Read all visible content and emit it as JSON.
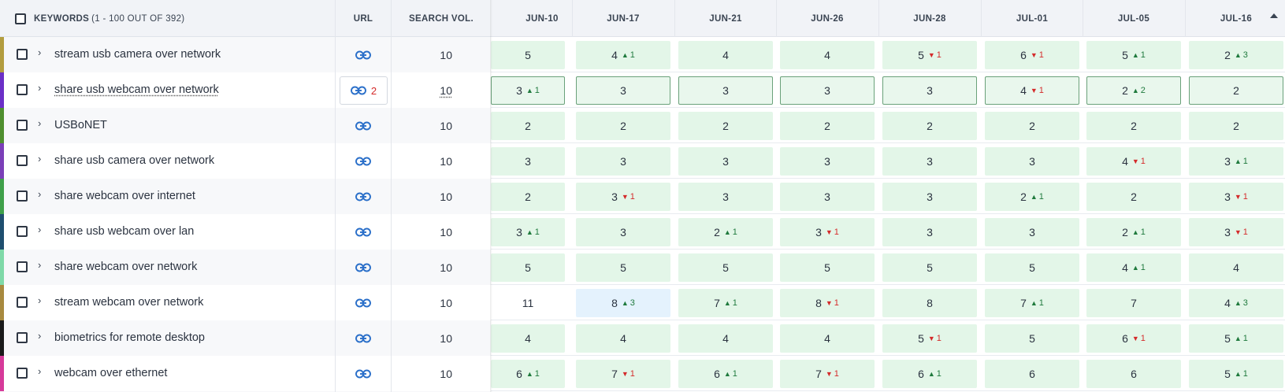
{
  "header": {
    "keywords_label": "KEYWORDS",
    "keywords_count": "(1 - 100 OUT OF 392)",
    "url_label": "URL",
    "volume_label": "SEARCH VOL.",
    "dates": [
      "JUN-10",
      "JUN-17",
      "JUN-21",
      "JUN-26",
      "JUN-28",
      "JUL-01",
      "JUL-05",
      "JUL-16"
    ]
  },
  "colors": {
    "positive_change": "#1f7a3d",
    "negative_change": "#d42b2b",
    "cell_green": "#e3f6e8",
    "cell_blue": "#e4f2fd"
  },
  "rows": [
    {
      "keyword": "stream usb camera over network",
      "stripe": "#b39d3f",
      "volume": "10",
      "cells": [
        {
          "v": "5",
          "c": "",
          "d": "",
          "bg": "green"
        },
        {
          "v": "4",
          "c": "1",
          "d": "up",
          "bg": "green"
        },
        {
          "v": "4",
          "c": "",
          "d": "",
          "bg": "green"
        },
        {
          "v": "4",
          "c": "",
          "d": "",
          "bg": "green"
        },
        {
          "v": "5",
          "c": "1",
          "d": "down",
          "bg": "green"
        },
        {
          "v": "6",
          "c": "1",
          "d": "down",
          "bg": "green"
        },
        {
          "v": "5",
          "c": "1",
          "d": "up",
          "bg": "green"
        },
        {
          "v": "2",
          "c": "3",
          "d": "up",
          "bg": "green"
        }
      ]
    },
    {
      "keyword": "share usb webcam over network",
      "stripe": "#6b2fc7",
      "volume": "10",
      "url_count": "2",
      "selected": true,
      "cells": [
        {
          "v": "3",
          "c": "1",
          "d": "up",
          "bg": "green"
        },
        {
          "v": "3",
          "c": "",
          "d": "",
          "bg": "green"
        },
        {
          "v": "3",
          "c": "",
          "d": "",
          "bg": "green"
        },
        {
          "v": "3",
          "c": "",
          "d": "",
          "bg": "green"
        },
        {
          "v": "3",
          "c": "",
          "d": "",
          "bg": "green"
        },
        {
          "v": "4",
          "c": "1",
          "d": "down",
          "bg": "green"
        },
        {
          "v": "2",
          "c": "2",
          "d": "up",
          "bg": "green"
        },
        {
          "v": "2",
          "c": "",
          "d": "",
          "bg": "green"
        }
      ]
    },
    {
      "keyword": "USBoNET",
      "stripe": "#4f8f2f",
      "volume": "10",
      "cells": [
        {
          "v": "2",
          "c": "",
          "d": "",
          "bg": "green"
        },
        {
          "v": "2",
          "c": "",
          "d": "",
          "bg": "green"
        },
        {
          "v": "2",
          "c": "",
          "d": "",
          "bg": "green"
        },
        {
          "v": "2",
          "c": "",
          "d": "",
          "bg": "green"
        },
        {
          "v": "2",
          "c": "",
          "d": "",
          "bg": "green"
        },
        {
          "v": "2",
          "c": "",
          "d": "",
          "bg": "green"
        },
        {
          "v": "2",
          "c": "",
          "d": "",
          "bg": "green"
        },
        {
          "v": "2",
          "c": "",
          "d": "",
          "bg": "green"
        }
      ]
    },
    {
      "keyword": "share usb camera over network",
      "stripe": "#7b3fb8",
      "volume": "10",
      "cells": [
        {
          "v": "3",
          "c": "",
          "d": "",
          "bg": "green"
        },
        {
          "v": "3",
          "c": "",
          "d": "",
          "bg": "green"
        },
        {
          "v": "3",
          "c": "",
          "d": "",
          "bg": "green"
        },
        {
          "v": "3",
          "c": "",
          "d": "",
          "bg": "green"
        },
        {
          "v": "3",
          "c": "",
          "d": "",
          "bg": "green"
        },
        {
          "v": "3",
          "c": "",
          "d": "",
          "bg": "green"
        },
        {
          "v": "4",
          "c": "1",
          "d": "down",
          "bg": "green"
        },
        {
          "v": "3",
          "c": "1",
          "d": "up",
          "bg": "green"
        }
      ]
    },
    {
      "keyword": "share webcam over internet",
      "stripe": "#3fa04a",
      "volume": "10",
      "cells": [
        {
          "v": "2",
          "c": "",
          "d": "",
          "bg": "green"
        },
        {
          "v": "3",
          "c": "1",
          "d": "down",
          "bg": "green"
        },
        {
          "v": "3",
          "c": "",
          "d": "",
          "bg": "green"
        },
        {
          "v": "3",
          "c": "",
          "d": "",
          "bg": "green"
        },
        {
          "v": "3",
          "c": "",
          "d": "",
          "bg": "green"
        },
        {
          "v": "2",
          "c": "1",
          "d": "up",
          "bg": "green"
        },
        {
          "v": "2",
          "c": "",
          "d": "",
          "bg": "green"
        },
        {
          "v": "3",
          "c": "1",
          "d": "down",
          "bg": "green"
        }
      ]
    },
    {
      "keyword": "share usb webcam over lan",
      "stripe": "#1f4f6f",
      "volume": "10",
      "cells": [
        {
          "v": "3",
          "c": "1",
          "d": "up",
          "bg": "green"
        },
        {
          "v": "3",
          "c": "",
          "d": "",
          "bg": "green"
        },
        {
          "v": "2",
          "c": "1",
          "d": "up",
          "bg": "green"
        },
        {
          "v": "3",
          "c": "1",
          "d": "down",
          "bg": "green"
        },
        {
          "v": "3",
          "c": "",
          "d": "",
          "bg": "green"
        },
        {
          "v": "3",
          "c": "",
          "d": "",
          "bg": "green"
        },
        {
          "v": "2",
          "c": "1",
          "d": "up",
          "bg": "green"
        },
        {
          "v": "3",
          "c": "1",
          "d": "down",
          "bg": "green"
        }
      ]
    },
    {
      "keyword": "share webcam over network",
      "stripe": "#7fd9a8",
      "volume": "10",
      "cells": [
        {
          "v": "5",
          "c": "",
          "d": "",
          "bg": "green"
        },
        {
          "v": "5",
          "c": "",
          "d": "",
          "bg": "green"
        },
        {
          "v": "5",
          "c": "",
          "d": "",
          "bg": "green"
        },
        {
          "v": "5",
          "c": "",
          "d": "",
          "bg": "green"
        },
        {
          "v": "5",
          "c": "",
          "d": "",
          "bg": "green"
        },
        {
          "v": "5",
          "c": "",
          "d": "",
          "bg": "green"
        },
        {
          "v": "4",
          "c": "1",
          "d": "up",
          "bg": "green"
        },
        {
          "v": "4",
          "c": "",
          "d": "",
          "bg": "green"
        }
      ]
    },
    {
      "keyword": "stream webcam over network",
      "stripe": "#a88a3f",
      "volume": "10",
      "cells": [
        {
          "v": "11",
          "c": "",
          "d": "",
          "bg": "plain"
        },
        {
          "v": "8",
          "c": "3",
          "d": "up",
          "bg": "blue"
        },
        {
          "v": "7",
          "c": "1",
          "d": "up",
          "bg": "green"
        },
        {
          "v": "8",
          "c": "1",
          "d": "down",
          "bg": "green"
        },
        {
          "v": "8",
          "c": "",
          "d": "",
          "bg": "green"
        },
        {
          "v": "7",
          "c": "1",
          "d": "up",
          "bg": "green"
        },
        {
          "v": "7",
          "c": "",
          "d": "",
          "bg": "green"
        },
        {
          "v": "4",
          "c": "3",
          "d": "up",
          "bg": "green"
        }
      ]
    },
    {
      "keyword": "biometrics for remote desktop",
      "stripe": "#1a1a1a",
      "volume": "10",
      "cells": [
        {
          "v": "4",
          "c": "",
          "d": "",
          "bg": "green"
        },
        {
          "v": "4",
          "c": "",
          "d": "",
          "bg": "green"
        },
        {
          "v": "4",
          "c": "",
          "d": "",
          "bg": "green"
        },
        {
          "v": "4",
          "c": "",
          "d": "",
          "bg": "green"
        },
        {
          "v": "5",
          "c": "1",
          "d": "down",
          "bg": "green"
        },
        {
          "v": "5",
          "c": "",
          "d": "",
          "bg": "green"
        },
        {
          "v": "6",
          "c": "1",
          "d": "down",
          "bg": "green"
        },
        {
          "v": "5",
          "c": "1",
          "d": "up",
          "bg": "green"
        }
      ]
    },
    {
      "keyword": "webcam over ethernet",
      "stripe": "#d63a9a",
      "volume": "10",
      "cells": [
        {
          "v": "6",
          "c": "1",
          "d": "up",
          "bg": "green"
        },
        {
          "v": "7",
          "c": "1",
          "d": "down",
          "bg": "green"
        },
        {
          "v": "6",
          "c": "1",
          "d": "up",
          "bg": "green"
        },
        {
          "v": "7",
          "c": "1",
          "d": "down",
          "bg": "green"
        },
        {
          "v": "6",
          "c": "1",
          "d": "up",
          "bg": "green"
        },
        {
          "v": "6",
          "c": "",
          "d": "",
          "bg": "green"
        },
        {
          "v": "6",
          "c": "",
          "d": "",
          "bg": "green"
        },
        {
          "v": "5",
          "c": "1",
          "d": "up",
          "bg": "green"
        }
      ]
    }
  ]
}
